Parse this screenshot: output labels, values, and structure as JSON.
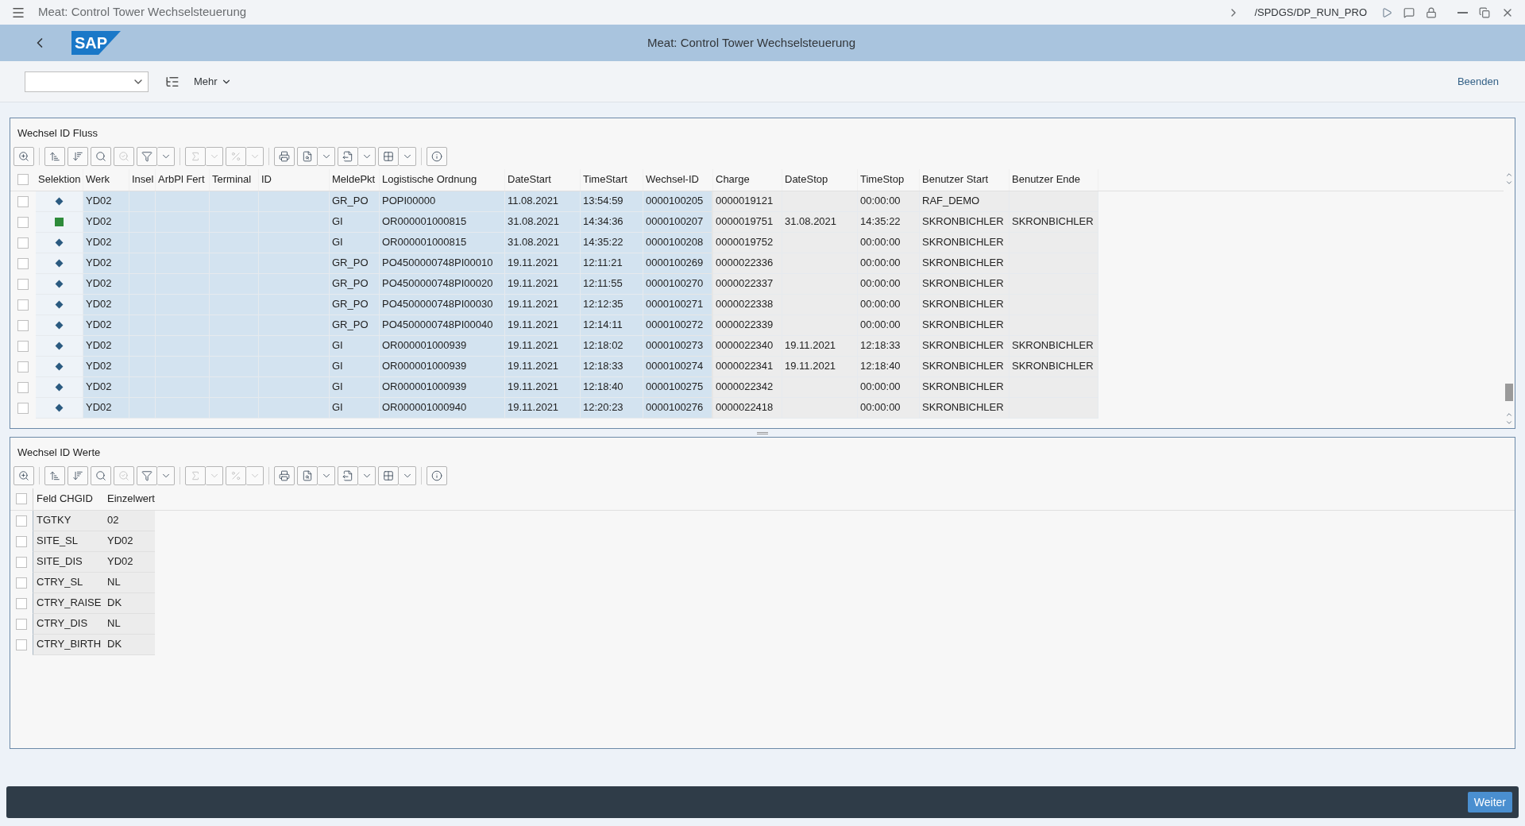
{
  "window": {
    "title": "Meat: Control Tower Wechselsteuerung",
    "transaction": "/SPDGS/DP_RUN_PRO"
  },
  "header": {
    "title": "Meat: Control Tower Wechselsteuerung",
    "logo": "SAP"
  },
  "toolbar": {
    "more": "Mehr",
    "exit": "Beenden"
  },
  "flow": {
    "title": "Wechsel ID Fluss",
    "all_selected": false,
    "columns": [
      "Selektion",
      "Werk",
      "Insel",
      "ArbPl Fert",
      "Terminal",
      "ID",
      "MeldePkt",
      "Logistische Ordnung",
      "DateStart",
      "TimeStart",
      "Wechsel-ID",
      "Charge",
      "DateStop",
      "TimeStop",
      "Benutzer Start",
      "Benutzer Ende"
    ],
    "rows": [
      {
        "kind": "diamond",
        "selected": false,
        "werk": "YD02",
        "meldepkt": "GR_PO",
        "ordnung": "POPI00000",
        "date_start": "11.08.2021",
        "time_start": "13:54:59",
        "wechsel_id": "0000100205",
        "charge": "0000019121",
        "time_stop": "00:00:00",
        "user_start": "RAF_DEMO"
      },
      {
        "kind": "square",
        "selected": false,
        "werk": "YD02",
        "meldepkt": "GI",
        "ordnung": "OR000001000815",
        "date_start": "31.08.2021",
        "time_start": "14:34:36",
        "wechsel_id": "0000100207",
        "charge": "0000019751",
        "date_stop": "31.08.2021",
        "time_stop": "14:35:22",
        "user_start": "SKRONBICHLER",
        "user_end": "SKRONBICHLER"
      },
      {
        "kind": "diamond",
        "selected": false,
        "werk": "YD02",
        "meldepkt": "GI",
        "ordnung": "OR000001000815",
        "date_start": "31.08.2021",
        "time_start": "14:35:22",
        "wechsel_id": "0000100208",
        "charge": "0000019752",
        "time_stop": "00:00:00",
        "user_start": "SKRONBICHLER"
      },
      {
        "kind": "diamond",
        "selected": false,
        "werk": "YD02",
        "meldepkt": "GR_PO",
        "ordnung": "PO4500000748PI00010",
        "date_start": "19.11.2021",
        "time_start": "12:11:21",
        "wechsel_id": "0000100269",
        "charge": "0000022336",
        "time_stop": "00:00:00",
        "user_start": "SKRONBICHLER"
      },
      {
        "kind": "diamond",
        "selected": false,
        "werk": "YD02",
        "meldepkt": "GR_PO",
        "ordnung": "PO4500000748PI00020",
        "date_start": "19.11.2021",
        "time_start": "12:11:55",
        "wechsel_id": "0000100270",
        "charge": "0000022337",
        "time_stop": "00:00:00",
        "user_start": "SKRONBICHLER"
      },
      {
        "kind": "diamond",
        "selected": false,
        "werk": "YD02",
        "meldepkt": "GR_PO",
        "ordnung": "PO4500000748PI00030",
        "date_start": "19.11.2021",
        "time_start": "12:12:35",
        "wechsel_id": "0000100271",
        "charge": "0000022338",
        "time_stop": "00:00:00",
        "user_start": "SKRONBICHLER"
      },
      {
        "kind": "diamond",
        "selected": false,
        "werk": "YD02",
        "meldepkt": "GR_PO",
        "ordnung": "PO4500000748PI00040",
        "date_start": "19.11.2021",
        "time_start": "12:14:11",
        "wechsel_id": "0000100272",
        "charge": "0000022339",
        "time_stop": "00:00:00",
        "user_start": "SKRONBICHLER"
      },
      {
        "kind": "diamond",
        "selected": false,
        "werk": "YD02",
        "meldepkt": "GI",
        "ordnung": "OR000001000939",
        "date_start": "19.11.2021",
        "time_start": "12:18:02",
        "wechsel_id": "0000100273",
        "charge": "0000022340",
        "date_stop": "19.11.2021",
        "time_stop": "12:18:33",
        "user_start": "SKRONBICHLER",
        "user_end": "SKRONBICHLER"
      },
      {
        "kind": "diamond",
        "selected": false,
        "werk": "YD02",
        "meldepkt": "GI",
        "ordnung": "OR000001000939",
        "date_start": "19.11.2021",
        "time_start": "12:18:33",
        "wechsel_id": "0000100274",
        "charge": "0000022341",
        "date_stop": "19.11.2021",
        "time_stop": "12:18:40",
        "user_start": "SKRONBICHLER",
        "user_end": "SKRONBICHLER"
      },
      {
        "kind": "diamond",
        "selected": false,
        "werk": "YD02",
        "meldepkt": "GI",
        "ordnung": "OR000001000939",
        "date_start": "19.11.2021",
        "time_start": "12:18:40",
        "wechsel_id": "0000100275",
        "charge": "0000022342",
        "time_stop": "00:00:00",
        "user_start": "SKRONBICHLER"
      },
      {
        "kind": "diamond",
        "selected": false,
        "werk": "YD02",
        "meldepkt": "GI",
        "ordnung": "OR000001000940",
        "date_start": "19.11.2021",
        "time_start": "12:20:23",
        "wechsel_id": "0000100276",
        "charge": "0000022418",
        "time_stop": "00:00:00",
        "user_start": "SKRONBICHLER"
      }
    ]
  },
  "values": {
    "title": "Wechsel ID Werte",
    "all_selected": false,
    "columns": [
      "Feld CHGID",
      "Einzelwert"
    ],
    "rows": [
      {
        "selected": false,
        "field": "TGTKY",
        "value": "02"
      },
      {
        "selected": false,
        "field": "SITE_SL",
        "value": "YD02"
      },
      {
        "selected": false,
        "field": "SITE_DIS",
        "value": "YD02"
      },
      {
        "selected": false,
        "field": "CTRY_SL",
        "value": "NL"
      },
      {
        "selected": false,
        "field": "CTRY_RAISE",
        "value": "DK"
      },
      {
        "selected": false,
        "field": "CTRY_DIS",
        "value": "NL"
      },
      {
        "selected": false,
        "field": "CTRY_BIRTH",
        "value": "DK"
      }
    ]
  },
  "footer": {
    "continue": "Weiter"
  }
}
